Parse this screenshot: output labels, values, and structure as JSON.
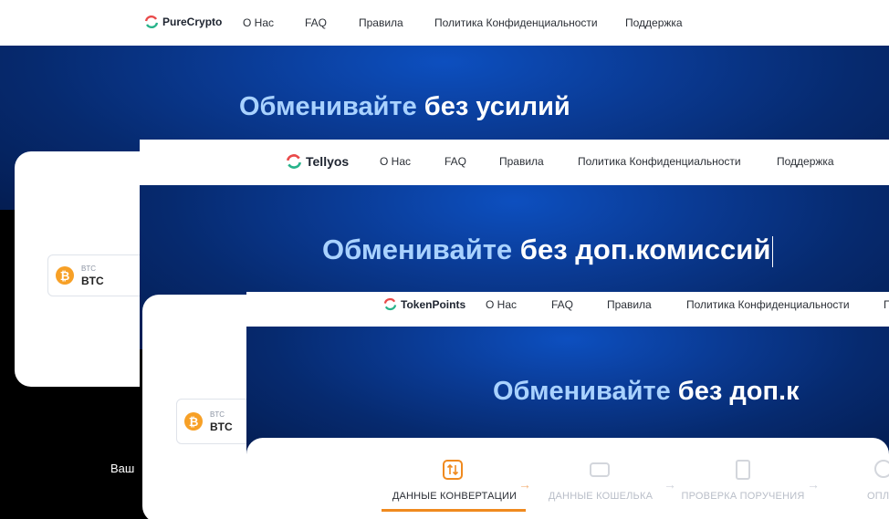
{
  "layer1": {
    "brand": "PureCrypto",
    "nav": [
      "О Нас",
      "FAQ",
      "Правила",
      "Политика Конфиденциальности",
      "Поддержка"
    ],
    "headline_highlight": "Обменивайте",
    "headline_rest": " без усилий",
    "coin_symbol": "₿",
    "coin_small": "BTC",
    "coin_big": "BTC",
    "footer_text": "Ваш"
  },
  "layer2": {
    "brand": "Tellyos",
    "nav": [
      "О Нас",
      "FAQ",
      "Правила",
      "Политика Конфиденциальности",
      "Поддержка"
    ],
    "headline_highlight": "Обменивайте",
    "headline_rest": " без доп.комиссий",
    "coin_symbol": "₿",
    "coin_small": "BTC",
    "coin_big": "BTC"
  },
  "layer3": {
    "brand": "TokenPoints",
    "nav": [
      "О Нас",
      "FAQ",
      "Правила",
      "Политика Конфиденциальности",
      "П"
    ],
    "headline_highlight": "Обменивайте",
    "headline_rest": " без доп.к",
    "steps": [
      {
        "label": "ДАННЫЕ КОНВЕРТАЦИИ",
        "icon": "swap-icon",
        "active": true
      },
      {
        "label": "ДАННЫЕ КОШЕЛЬКА",
        "icon": "wallet-icon",
        "active": false
      },
      {
        "label": "ПРОВЕРКА ПОРУЧЕНИЯ",
        "icon": "document-icon",
        "active": false
      },
      {
        "label": "ОПЛА",
        "icon": "badge-icon",
        "active": false
      }
    ],
    "step_arrow": "→"
  },
  "colors": {
    "accent_orange": "#f08a1f",
    "headline_blue": "#a9d2ff",
    "hero_blue": "#0a3a93"
  }
}
